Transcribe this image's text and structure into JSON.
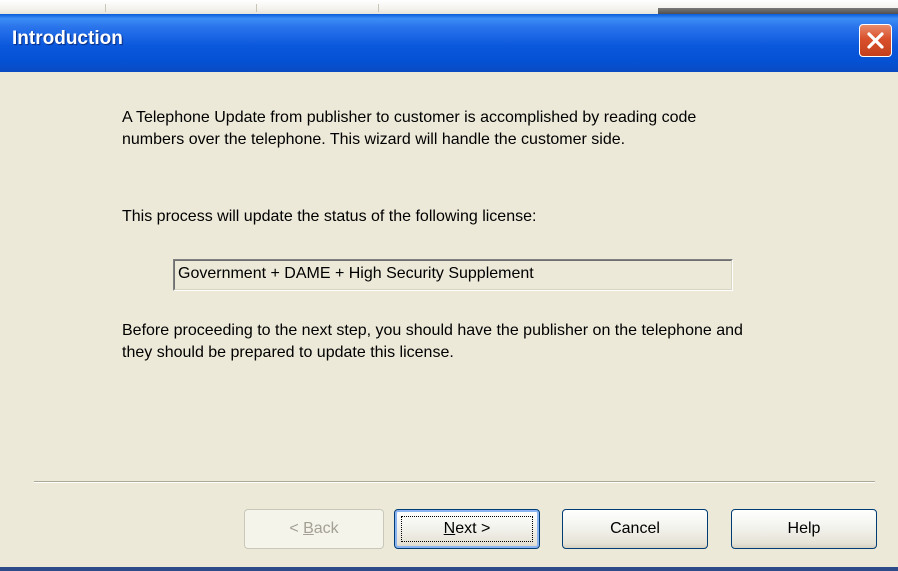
{
  "window": {
    "title": "Introduction",
    "close_icon": "close-icon"
  },
  "body": {
    "paragraph1": "A Telephone Update from publisher to customer is accomplished by reading code numbers over the telephone. This wizard will handle the customer side.",
    "paragraph2": "This process will update the status of the following license:",
    "license_value": "Government + DAME + High Security Supplement",
    "paragraph3": "Before proceeding to the next step, you should have the publisher on the telephone and they should be prepared to update this license."
  },
  "buttons": {
    "back": {
      "before": "< ",
      "mnemonic": "B",
      "after": "ack",
      "enabled": false
    },
    "next": {
      "mnemonic": "N",
      "after": "ext >",
      "enabled": true
    },
    "cancel": "Cancel",
    "help": "Help"
  },
  "colors": {
    "titlebar": "#0b58dd",
    "dialog_background": "#ece9d8",
    "close_button": "#d9502b",
    "disabled_text": "#a3a095"
  }
}
